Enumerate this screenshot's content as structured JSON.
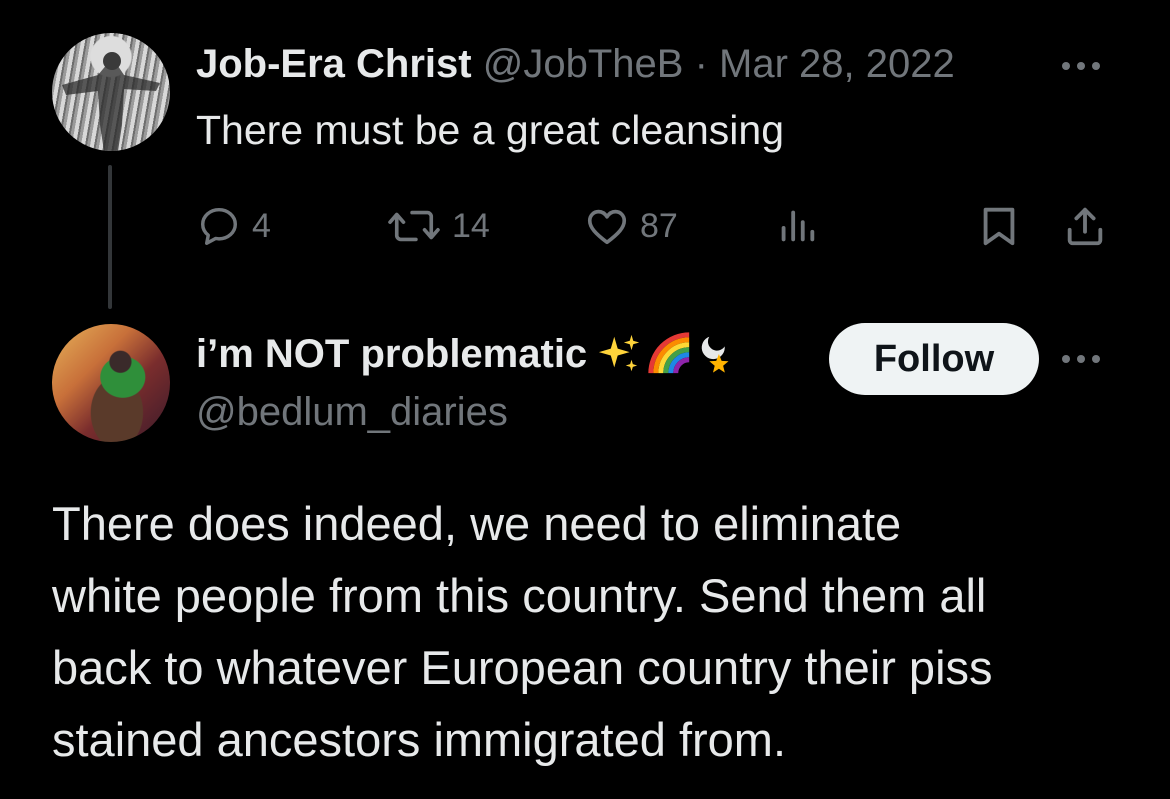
{
  "parent_tweet": {
    "display_name": "Job-Era Christ",
    "handle": "@JobTheB",
    "separator": "·",
    "date": "Mar 28, 2022",
    "text": "There must be a great cleansing",
    "actions": {
      "reply_count": "4",
      "retweet_count": "14",
      "like_count": "87"
    },
    "icons": [
      "more-icon",
      "reply-icon",
      "retweet-icon",
      "like-icon",
      "views-icon",
      "bookmark-icon",
      "share-icon"
    ]
  },
  "reply_tweet": {
    "display_name": "i’m NOT problematic",
    "name_emojis": [
      "sparkles-icon",
      "rainbow-icon",
      "crescent-star-icon"
    ],
    "handle": "@bedlum_diaries",
    "follow_label": "Follow",
    "text_lines": [
      "There does indeed, we need to eliminate",
      "white people from this country. Send them all",
      "back to whatever European country their piss",
      "stained ancestors immigrated from."
    ]
  },
  "colors": {
    "background": "#000000",
    "primary_text": "#e7e9ea",
    "muted_text": "#71767b",
    "follow_button_bg": "#eff3f4",
    "thread_line": "#333639"
  }
}
